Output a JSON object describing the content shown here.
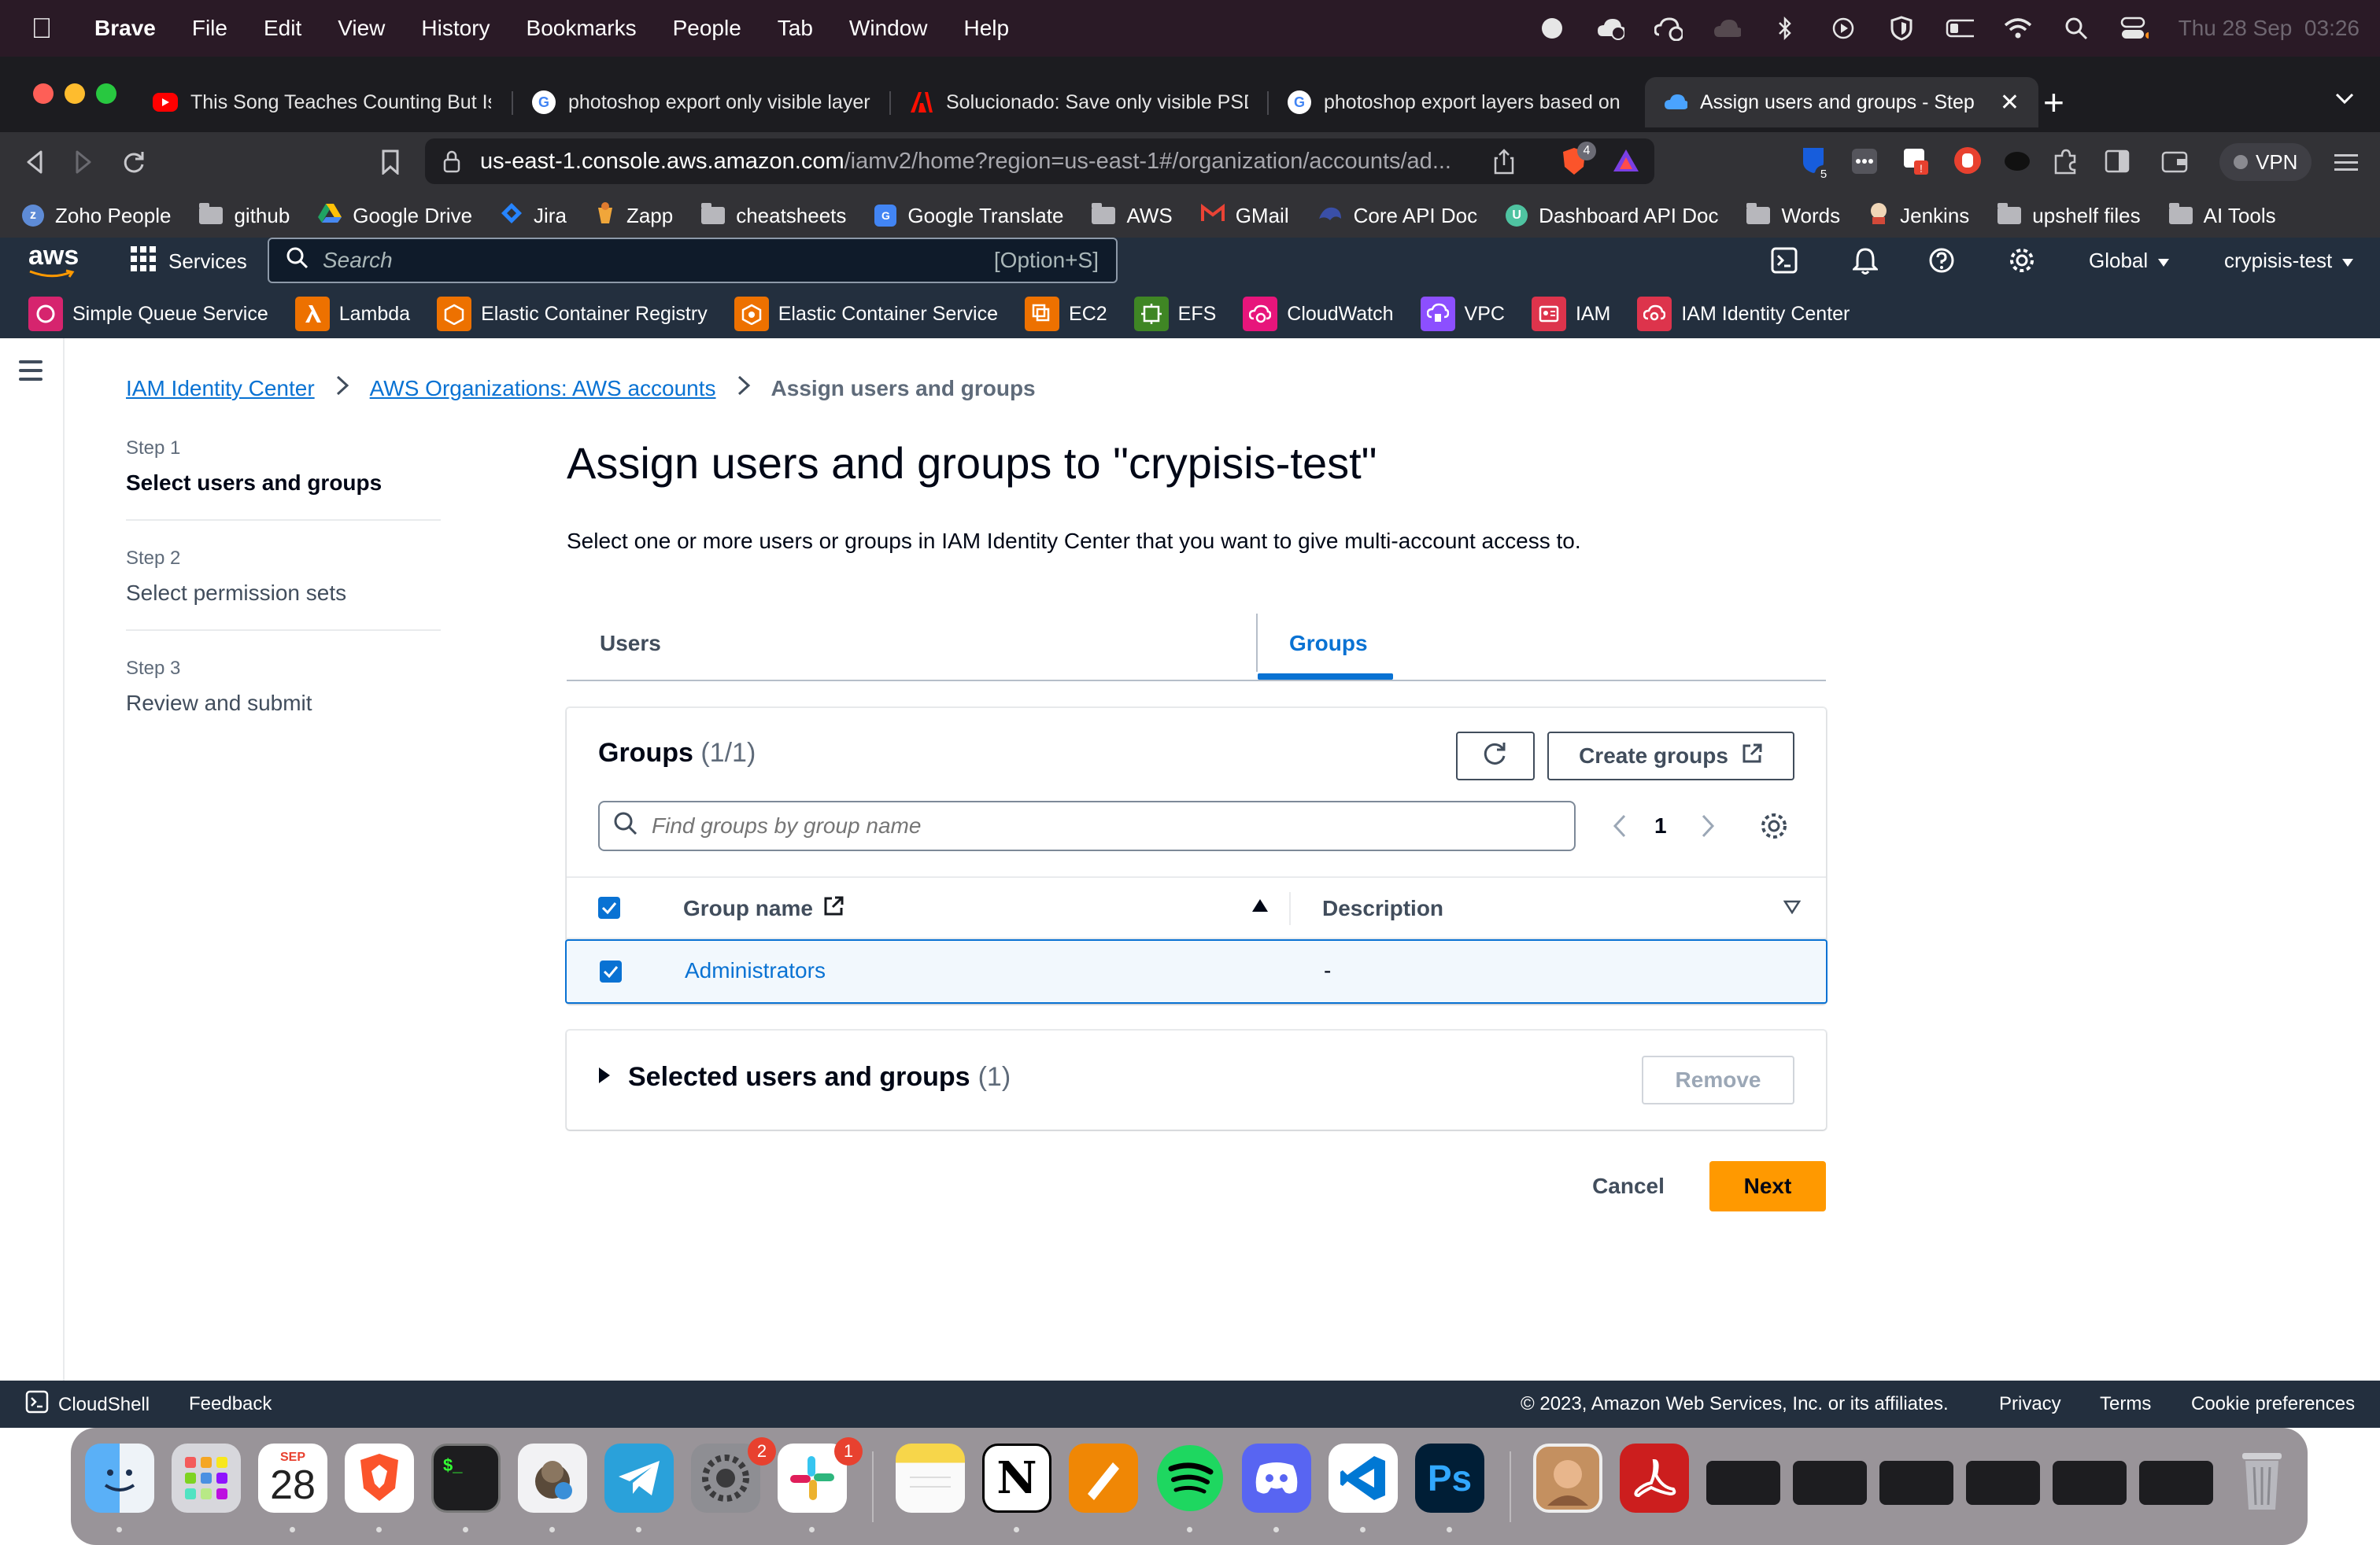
{
  "menubar": {
    "app": "Brave",
    "items": [
      "File",
      "Edit",
      "View",
      "History",
      "Bookmarks",
      "People",
      "Tab",
      "Window",
      "Help"
    ],
    "clock": "Thu 28 Sep  03:26"
  },
  "tabs": [
    {
      "title": "This Song Teaches Counting But Is",
      "favicon": "youtube-icon"
    },
    {
      "title": "photoshop export only visible layers",
      "favicon": "google-icon"
    },
    {
      "title": "Solucionado: Save only visible PSD",
      "favicon": "adobe-icon"
    },
    {
      "title": "photoshop export layers based on a",
      "favicon": "google-icon"
    },
    {
      "title": "Assign users and groups - Step",
      "favicon": "aws-cloud-icon",
      "active": true
    }
  ],
  "address": {
    "host": "us-east-1.console.aws.amazon.com",
    "path": "/iamv2/home?region=us-east-1#/organization/accounts/ad...",
    "shields_count": "4",
    "vpn": "VPN",
    "ext_badge": "5"
  },
  "bookmarks": [
    "Zoho People",
    "github",
    "Google Drive",
    "Jira",
    "Zapp",
    "cheatsheets",
    "Google Translate",
    "AWS",
    "GMail",
    "Core API Doc",
    "Dashboard API Doc",
    "Words",
    "Jenkins",
    "upshelf files",
    "AI Tools"
  ],
  "aws": {
    "logo": "aws",
    "services": "Services",
    "search_placeholder": "Search",
    "search_shortcut": "[Option+S]",
    "region": "Global",
    "account": "crypisis-test",
    "favorites": [
      "Simple Queue Service",
      "Lambda",
      "Elastic Container Registry",
      "Elastic Container Service",
      "EC2",
      "EFS",
      "CloudWatch",
      "VPC",
      "IAM",
      "IAM Identity Center"
    ]
  },
  "breadcrumb": {
    "items": [
      "IAM Identity Center",
      "AWS Organizations: AWS accounts"
    ],
    "current": "Assign users and groups"
  },
  "steps": [
    {
      "number": "Step 1",
      "title": "Select users and groups"
    },
    {
      "number": "Step 2",
      "title": "Select permission sets"
    },
    {
      "number": "Step 3",
      "title": "Review and submit"
    }
  ],
  "page": {
    "title": "Assign users and groups to \"crypisis-test\"",
    "description": "Select one or more users or groups in IAM Identity Center that you want to give multi-account access to."
  },
  "content_tabs": [
    "Users",
    "Groups"
  ],
  "groups_panel": {
    "title": "Groups",
    "count": "(1/1)",
    "create_label": "Create groups",
    "search_placeholder": "Find groups by group name",
    "page": "1",
    "columns": [
      "Group name",
      "Description"
    ],
    "rows": [
      {
        "name": "Administrators",
        "description": "-"
      }
    ]
  },
  "selected_panel": {
    "title": "Selected users and groups",
    "count": "(1)",
    "remove_label": "Remove"
  },
  "actions": {
    "cancel": "Cancel",
    "next": "Next"
  },
  "footer": {
    "cloudshell": "CloudShell",
    "feedback": "Feedback",
    "copyright": "© 2023, Amazon Web Services, Inc. or its affiliates.",
    "links": [
      "Privacy",
      "Terms",
      "Cookie preferences"
    ]
  },
  "dock": {
    "calendar_month": "SEP",
    "calendar_day": "28",
    "settings_badge": "2",
    "slack_badge": "1",
    "terminal_prompt": "$_",
    "notion": "N",
    "photoshop": "Ps",
    "apps": [
      "finder-icon",
      "launchpad-icon",
      "calendar-icon",
      "brave-icon",
      "terminal-icon",
      "sequel-ace-icon",
      "telegram-icon",
      "system-settings-icon",
      "slack-icon",
      "notes-icon",
      "notion-icon",
      "drawio-icon",
      "spotify-icon",
      "discord-icon",
      "vscode-icon",
      "photoshop-icon",
      "preview-icon",
      "acrobat-icon",
      "brave-window-icon",
      "trash-icon"
    ]
  },
  "colors": {
    "accent": "#0972d3",
    "aws_header": "#232f3e",
    "primary_button": "#ff9900"
  }
}
